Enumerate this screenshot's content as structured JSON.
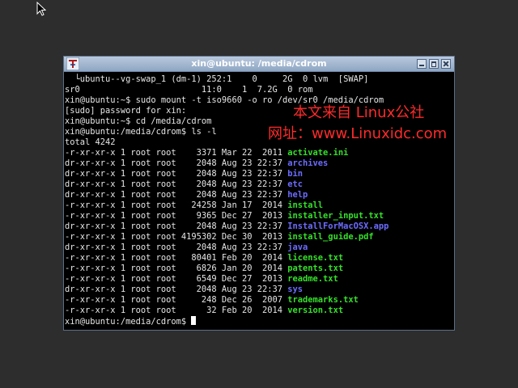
{
  "window": {
    "title": "xin@ubuntu: /media/cdrom"
  },
  "terminal": {
    "lines": [
      {
        "segments": [
          {
            "text": "  └ubuntu--vg-swap_1 (dm-1) 252:1    0     2G  0 lvm  [SWAP]",
            "cls": ""
          }
        ]
      },
      {
        "segments": [
          {
            "text": "sr0                        11:0    1  7.2G  0 rom",
            "cls": ""
          }
        ]
      },
      {
        "segments": [
          {
            "text": "xin@ubuntu:~$ sudo mount -t iso9660 -o ro /dev/sr0 /media/cdrom",
            "cls": ""
          }
        ]
      },
      {
        "segments": [
          {
            "text": "[sudo] password for xin:",
            "cls": ""
          }
        ]
      },
      {
        "segments": [
          {
            "text": "xin@ubuntu:~$ cd /media/cdrom",
            "cls": ""
          }
        ]
      },
      {
        "segments": [
          {
            "text": "xin@ubuntu:/media/cdrom$ ls -l",
            "cls": ""
          }
        ]
      },
      {
        "segments": [
          {
            "text": "total 4242",
            "cls": ""
          }
        ]
      },
      {
        "segments": [
          {
            "text": "-r-xr-xr-x 1 root root    3371 Mar 22  2011 ",
            "cls": ""
          },
          {
            "text": "activate.ini",
            "cls": "exe"
          }
        ]
      },
      {
        "segments": [
          {
            "text": "dr-xr-xr-x 1 root root    2048 Aug 23 22:37 ",
            "cls": ""
          },
          {
            "text": "archives",
            "cls": "dir"
          }
        ]
      },
      {
        "segments": [
          {
            "text": "dr-xr-xr-x 1 root root    2048 Aug 23 22:37 ",
            "cls": ""
          },
          {
            "text": "bin",
            "cls": "dir"
          }
        ]
      },
      {
        "segments": [
          {
            "text": "dr-xr-xr-x 1 root root    2048 Aug 23 22:37 ",
            "cls": ""
          },
          {
            "text": "etc",
            "cls": "dir"
          }
        ]
      },
      {
        "segments": [
          {
            "text": "dr-xr-xr-x 1 root root    2048 Aug 23 22:37 ",
            "cls": ""
          },
          {
            "text": "help",
            "cls": "dir"
          }
        ]
      },
      {
        "segments": [
          {
            "text": "-r-xr-xr-x 1 root root   24258 Jan 17  2014 ",
            "cls": ""
          },
          {
            "text": "install",
            "cls": "exe"
          }
        ]
      },
      {
        "segments": [
          {
            "text": "-r-xr-xr-x 1 root root    9365 Dec 27  2013 ",
            "cls": ""
          },
          {
            "text": "installer_input.txt",
            "cls": "exe"
          }
        ]
      },
      {
        "segments": [
          {
            "text": "dr-xr-xr-x 1 root root    2048 Aug 23 22:37 ",
            "cls": ""
          },
          {
            "text": "InstallForMacOSX.app",
            "cls": "dir"
          }
        ]
      },
      {
        "segments": [
          {
            "text": "-r-xr-xr-x 1 root root 4195302 Dec 30  2013 ",
            "cls": ""
          },
          {
            "text": "install_guide.pdf",
            "cls": "exe"
          }
        ]
      },
      {
        "segments": [
          {
            "text": "dr-xr-xr-x 1 root root    2048 Aug 23 22:37 ",
            "cls": ""
          },
          {
            "text": "java",
            "cls": "dir"
          }
        ]
      },
      {
        "segments": [
          {
            "text": "-r-xr-xr-x 1 root root   80401 Feb 20  2014 ",
            "cls": ""
          },
          {
            "text": "license.txt",
            "cls": "exe"
          }
        ]
      },
      {
        "segments": [
          {
            "text": "-r-xr-xr-x 1 root root    6826 Jan 20  2014 ",
            "cls": ""
          },
          {
            "text": "patents.txt",
            "cls": "exe"
          }
        ]
      },
      {
        "segments": [
          {
            "text": "-r-xr-xr-x 1 root root    6549 Dec 27  2013 ",
            "cls": ""
          },
          {
            "text": "readme.txt",
            "cls": "exe"
          }
        ]
      },
      {
        "segments": [
          {
            "text": "dr-xr-xr-x 1 root root    2048 Aug 23 22:37 ",
            "cls": ""
          },
          {
            "text": "sys",
            "cls": "dir"
          }
        ]
      },
      {
        "segments": [
          {
            "text": "-r-xr-xr-x 1 root root     248 Dec 26  2007 ",
            "cls": ""
          },
          {
            "text": "trademarks.txt",
            "cls": "exe"
          }
        ]
      },
      {
        "segments": [
          {
            "text": "-r-xr-xr-x 1 root root      32 Feb 20  2014 ",
            "cls": ""
          },
          {
            "text": "version.txt",
            "cls": "exe"
          }
        ]
      }
    ],
    "prompt": "xin@ubuntu:/media/cdrom$ "
  },
  "watermark": {
    "line1": "本文来自 Linux公社",
    "line2": "网址：www.Linuxidc.com"
  },
  "colors": {
    "executable": "#35e02a",
    "directory": "#6c6cff",
    "watermark": "#ff2a2a"
  },
  "icons": {
    "mouse_pointer": "arrow-cursor-icon",
    "app_icon": "terminal-app-icon",
    "minimize": "minimize-icon",
    "maximize": "maximize-icon",
    "close": "close-icon"
  }
}
